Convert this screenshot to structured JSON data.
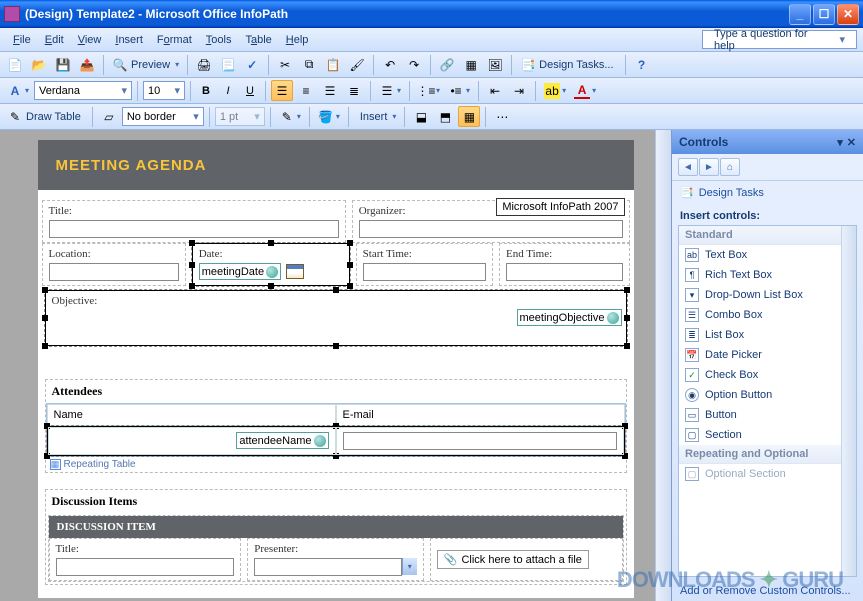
{
  "window": {
    "title": "(Design) Template2 - Microsoft Office InfoPath"
  },
  "menu": [
    "File",
    "Edit",
    "View",
    "Insert",
    "Format",
    "Tools",
    "Table",
    "Help"
  ],
  "help_placeholder": "Type a question for help",
  "toolbar1": {
    "preview": "Preview",
    "design_tasks": "Design Tasks..."
  },
  "toolbar2": {
    "font": "Verdana",
    "size": "10"
  },
  "toolbar3": {
    "draw_table": "Draw Table",
    "border_style": "No border",
    "width": "1 pt",
    "insert": "Insert"
  },
  "form": {
    "heading": "MEETING AGENDA",
    "labels": {
      "title": "Title:",
      "organizer": "Organizer:",
      "location": "Location:",
      "date": "Date:",
      "start": "Start Time:",
      "end": "End Time:",
      "objective": "Objective:"
    },
    "tooltip_product": "Microsoft InfoPath 2007",
    "field_meetingDate": "meetingDate",
    "field_meetingObjective": "meetingObjective",
    "attendees_title": "Attendees",
    "attendees_cols": {
      "name": "Name",
      "email": "E-mail"
    },
    "field_attendeeName": "attendeeName",
    "repeating_table": "Repeating Table",
    "discussion_title": "Discussion Items",
    "discussion_bar": "DISCUSSION ITEM",
    "disc_labels": {
      "title": "Title:",
      "presenter": "Presenter:"
    },
    "attach": "Click here to attach a file"
  },
  "taskpane": {
    "title": "Controls",
    "design_tasks": "Design Tasks",
    "insert_title": "Insert controls:",
    "cat_standard": "Standard",
    "items": [
      "Text Box",
      "Rich Text Box",
      "Drop-Down List Box",
      "Combo Box",
      "List Box",
      "Date Picker",
      "Check Box",
      "Option Button",
      "Button",
      "Section"
    ],
    "cat_repeat": "Repeating and Optional",
    "items2": [
      "Optional Section"
    ],
    "footer": "Add or Remove Custom Controls..."
  },
  "watermark": {
    "a": "DOWNLOADS",
    "b": "GURU"
  }
}
